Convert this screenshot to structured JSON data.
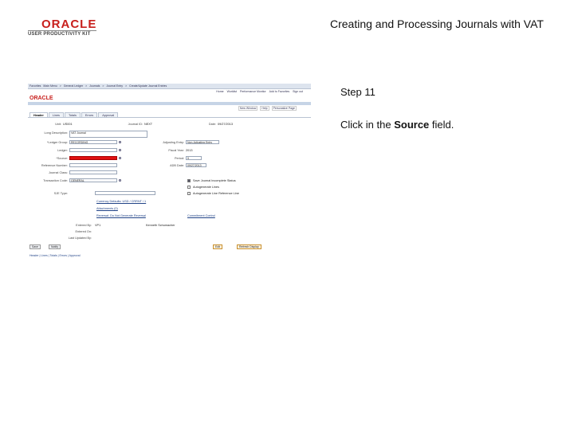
{
  "header": {
    "logo_text": "ORACLE",
    "logo_sub": "USER PRODUCTIVITY KIT",
    "doc_title": "Creating and Processing Journals with VAT"
  },
  "step": {
    "label": "Step 11",
    "instr_prefix": "Click in the ",
    "instr_field": "Source",
    "instr_suffix": " field."
  },
  "app": {
    "menubar": [
      "Favorites",
      "Main Menu",
      ">",
      "General Ledger",
      ">",
      "Journals",
      ">",
      "Journal Entry",
      ">",
      "Create/Update Journal Entries"
    ],
    "toplinks": [
      "Home",
      "Worklist",
      "Performance Monitor",
      "Add to Favorites",
      "Sign out"
    ],
    "logo": "ORACLE",
    "sublinks": [
      "New Window",
      "Help",
      "Personalize Page"
    ],
    "tabs": [
      "Header",
      "Lines",
      "Totals",
      "Errors",
      "Approval"
    ],
    "active_tab": "Header",
    "unit_label": "Unit:",
    "unit_value": "US001",
    "journal_id_label": "Journal ID:",
    "journal_id_value": "NEXT",
    "date_label": "Date:",
    "date_value": "09/27/2013",
    "long_desc_label": "Long Description:",
    "long_desc_value": "VAT Journal",
    "ledger_group_label": "*Ledger Group:",
    "ledger_group_value": "RECORDING",
    "adjusting_entry_label": "Adjusting Entry:",
    "adjusting_entry_value": "Non-Adjusting Entry",
    "ledger_label": "Ledger:",
    "fiscal_year_label": "Fiscal Year:",
    "fiscal_year_value": "2013",
    "source_label": "*Source:",
    "period_label": "Period:",
    "period_value": "9",
    "reference_label": "Reference Number:",
    "adb_date_label": "ADB Date:",
    "adb_date_value": "09/27/2013",
    "journal_class_label": "Journal Class:",
    "trans_code_label": "Transaction Code:",
    "trans_code_value": "GENERAL",
    "save_edit_label": "Save Journal Incomplete Status",
    "auto_gen_label": "Autogenerate Lines",
    "rev_label": "Reversal - Do Not Generate Reversal",
    "sje_label": "SJE Type:",
    "auto_date_label": "Autogenerate Line Reference Line",
    "currency_link": "Currency Defaults: USD / CRRNT / 1",
    "attachments_link": "Attachments (0)",
    "reversal_link": "Reversal: Do Not Generate Reversal",
    "commitment_link": "Commitment Control",
    "entered_by_label": "Entered By:",
    "entered_by_value": "VP1",
    "entered_on_label": "Entered On:",
    "last_updated_label": "Last Updated By:",
    "entered_by_name": "Kenneth Schumacher",
    "save_button": "Save",
    "notify_button": "Notify",
    "edit_button": "Edit",
    "refresh_button": "Refresh Display",
    "footer": "Header | Lines | Totals | Errors | Approval"
  },
  "colors": {
    "logo_red": "#c8201d",
    "highlight_red": "#e01010",
    "band_blue": "#c6d4e6"
  }
}
